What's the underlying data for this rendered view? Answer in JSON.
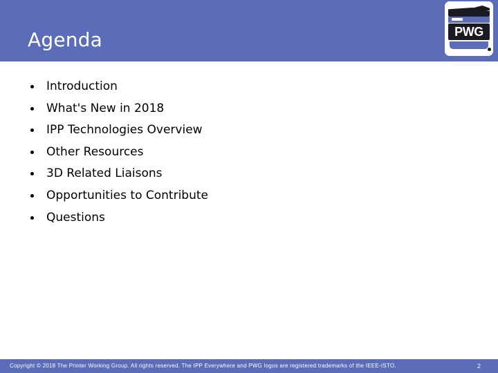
{
  "slide": {
    "title": "Agenda",
    "theme": {
      "band_color": "#5b6cb8",
      "body_background": "#ffffff",
      "title_color": "#ffffff",
      "body_text_color": "#000000"
    }
  },
  "logo": {
    "name": "pwg-logo",
    "text": "PWG",
    "alt": "PWG printer logo"
  },
  "agenda": {
    "items": [
      {
        "label": "Introduction"
      },
      {
        "label": "What's New in 2018"
      },
      {
        "label": "IPP Technologies Overview"
      },
      {
        "label": "Other Resources"
      },
      {
        "label": "3D Related Liaisons"
      },
      {
        "label": "Opportunities to Contribute"
      },
      {
        "label": "Questions"
      }
    ]
  },
  "footer": {
    "copyright": "Copyright © 2018 The Printer Working Group. All rights reserved. The IPP Everywhere and PWG logos are registered trademarks of the IEEE-ISTO.",
    "page_number": "2"
  }
}
